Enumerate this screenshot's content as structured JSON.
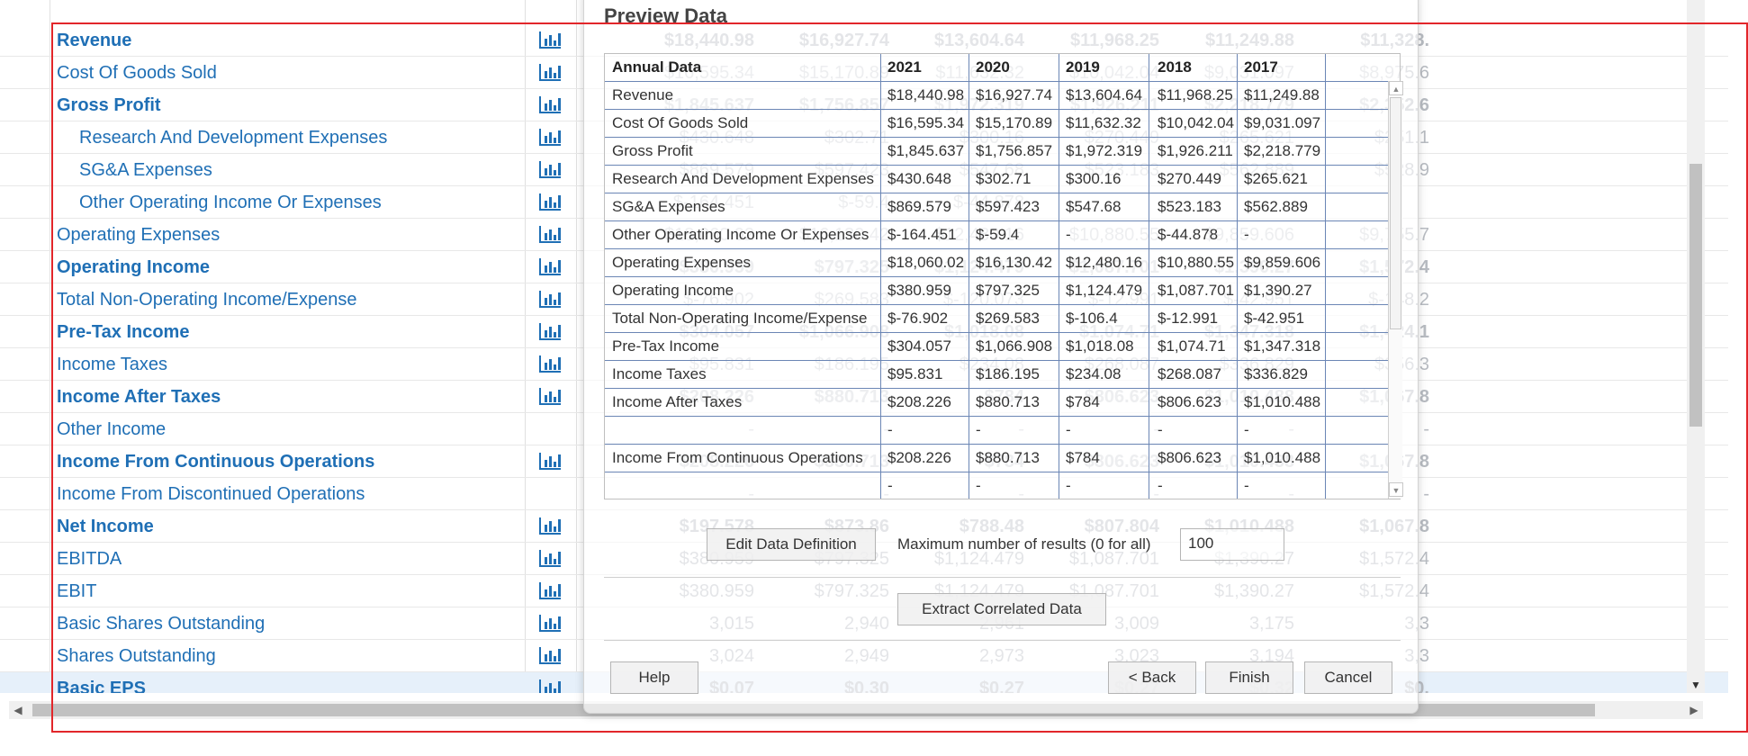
{
  "sheet": {
    "rows": [
      {
        "label": "Revenue",
        "bold": true,
        "indent": false,
        "icon": true,
        "values": [
          "$18,440.98",
          "$16,927.74",
          "$13,604.64",
          "$11,968.25",
          "$11,249.88",
          "$11,328."
        ]
      },
      {
        "label": "Cost Of Goods Sold",
        "bold": false,
        "indent": false,
        "icon": true,
        "values": [
          "$16,595.34",
          "$15,170.89",
          "$11,632.32",
          "$10,042.04",
          "$9,031.097",
          "$8,975.6"
        ]
      },
      {
        "label": "Gross Profit",
        "bold": true,
        "indent": false,
        "icon": true,
        "values": [
          "$1,845.637",
          "$1,756.857",
          "$1,972.319",
          "$1,926.211",
          "$2,218.779",
          "$2,352.6"
        ]
      },
      {
        "label": "Research And Development Expenses",
        "bold": false,
        "indent": true,
        "icon": true,
        "values": [
          "$430.648",
          "$302.71",
          "$300.16",
          "$270.449",
          "$265.621",
          "$251.1"
        ]
      },
      {
        "label": "SG&A Expenses",
        "bold": false,
        "indent": true,
        "icon": true,
        "values": [
          "$869.579",
          "$597.423",
          "$547.68",
          "$523.183",
          "$562.889",
          "$528.9"
        ]
      },
      {
        "label": "Other Operating Income Or Expenses",
        "bold": false,
        "indent": true,
        "icon": true,
        "values": [
          "$-164.451",
          "$-59.4",
          "$-44.878",
          "",
          "",
          ""
        ]
      },
      {
        "label": "Operating Expenses",
        "bold": false,
        "indent": false,
        "icon": true,
        "values": [
          "$18,060.02",
          "$16,130.42",
          "$12,480.16",
          "$10,880.55",
          "$9,859.606",
          "$9,755.7"
        ]
      },
      {
        "label": "Operating Income",
        "bold": true,
        "indent": false,
        "icon": true,
        "values": [
          "$380.959",
          "$797.325",
          "$1,124.479",
          "$1,087.701",
          "$1,390.27",
          "$1,572.4"
        ]
      },
      {
        "label": "Total Non-Operating Income/Expense",
        "bold": false,
        "indent": false,
        "icon": true,
        "values": [
          "$-76.902",
          "$269.583",
          "$-120.073",
          "$-12.991",
          "$-42.951",
          "$-148.2"
        ]
      },
      {
        "label": "Pre-Tax Income",
        "bold": true,
        "indent": false,
        "icon": true,
        "values": [
          "$304.057",
          "$1,066.908",
          "$1,018.08",
          "$1,074.71",
          "$1,347.318",
          "$1,424.1"
        ]
      },
      {
        "label": "Income Taxes",
        "bold": false,
        "indent": false,
        "icon": true,
        "values": [
          "$95.831",
          "$186.195",
          "$234.08",
          "$268.087",
          "$336.829",
          "$356.3"
        ]
      },
      {
        "label": "Income After Taxes",
        "bold": true,
        "indent": false,
        "icon": true,
        "values": [
          "$208.226",
          "$880.713",
          "$784",
          "$806.623",
          "$1,010.488",
          "$1,067.8"
        ]
      },
      {
        "label": "Other Income",
        "bold": false,
        "indent": false,
        "icon": false,
        "values": [
          "-",
          "-",
          "-",
          "-",
          "-",
          "-"
        ]
      },
      {
        "label": "Income From Continuous Operations",
        "bold": true,
        "indent": false,
        "icon": true,
        "values": [
          "$208.226",
          "$880.713",
          "$784",
          "$806.623",
          "$1,010.488",
          "$1,067.8"
        ]
      },
      {
        "label": "Income From Discontinued Operations",
        "bold": false,
        "indent": false,
        "icon": false,
        "values": [
          "-",
          "-",
          "-",
          "-",
          "-",
          "-"
        ]
      },
      {
        "label": "Net Income",
        "bold": true,
        "indent": false,
        "icon": true,
        "values": [
          "$197.578",
          "$873.86",
          "$788.48",
          "$807.804",
          "$1,010.488",
          "$1,067.8"
        ]
      },
      {
        "label": "EBITDA",
        "bold": false,
        "indent": false,
        "icon": true,
        "values": [
          "$380.959",
          "$797.325",
          "$1,124.479",
          "$1,087.701",
          "$1,390.27",
          "$1,572.4"
        ]
      },
      {
        "label": "EBIT",
        "bold": false,
        "indent": false,
        "icon": true,
        "values": [
          "$380.959",
          "$797.325",
          "$1,124.479",
          "$1,087.701",
          "$1,390.27",
          "$1,572.4"
        ]
      },
      {
        "label": "Basic Shares Outstanding",
        "bold": false,
        "indent": false,
        "icon": true,
        "values": [
          "3,015",
          "2,940",
          "2,961",
          "3,009",
          "3,175",
          "3,3"
        ]
      },
      {
        "label": "Shares Outstanding",
        "bold": false,
        "indent": false,
        "icon": true,
        "values": [
          "3,024",
          "2,949",
          "2,973",
          "3,023",
          "3,194",
          "3,3"
        ]
      },
      {
        "label": "Basic EPS",
        "bold": true,
        "indent": false,
        "icon": true,
        "selected": true,
        "values": [
          "$0.07",
          "$0.30",
          "$0.27",
          "$0.27",
          "$0.32",
          "$0."
        ]
      }
    ]
  },
  "dialog": {
    "title": "Preview Data",
    "grid": {
      "headers": [
        "Annual Data",
        "2021",
        "2020",
        "2019",
        "2018",
        "2017"
      ],
      "rows": [
        [
          "Revenue",
          "$18,440.98",
          "$16,927.74",
          "$13,604.64",
          "$11,968.25",
          "$11,249.88"
        ],
        [
          "Cost Of Goods Sold",
          "$16,595.34",
          "$15,170.89",
          "$11,632.32",
          "$10,042.04",
          "$9,031.097"
        ],
        [
          "Gross Profit",
          "$1,845.637",
          "$1,756.857",
          "$1,972.319",
          "$1,926.211",
          "$2,218.779"
        ],
        [
          "Research And Development Expenses",
          "$430.648",
          "$302.71",
          "$300.16",
          "$270.449",
          "$265.621"
        ],
        [
          "SG&A Expenses",
          "$869.579",
          "$597.423",
          "$547.68",
          "$523.183",
          "$562.889"
        ],
        [
          "Other Operating Income Or Expenses",
          "$-164.451",
          "$-59.4",
          "-",
          "$-44.878",
          "-"
        ],
        [
          "Operating Expenses",
          "$18,060.02",
          "$16,130.42",
          "$12,480.16",
          "$10,880.55",
          "$9,859.606"
        ],
        [
          "Operating Income",
          "$380.959",
          "$797.325",
          "$1,124.479",
          "$1,087.701",
          "$1,390.27"
        ],
        [
          "Total Non-Operating Income/Expense",
          "$-76.902",
          "$269.583",
          "$-106.4",
          "$-12.991",
          "$-42.951"
        ],
        [
          "Pre-Tax Income",
          "$304.057",
          "$1,066.908",
          "$1,018.08",
          "$1,074.71",
          "$1,347.318"
        ],
        [
          "Income Taxes",
          "$95.831",
          "$186.195",
          "$234.08",
          "$268.087",
          "$336.829"
        ],
        [
          "Income After Taxes",
          "$208.226",
          "$880.713",
          "$784",
          "$806.623",
          "$1,010.488"
        ],
        [
          "",
          "-",
          "-",
          "-",
          "-",
          "-"
        ],
        [
          "Income From Continuous Operations",
          "$208.226",
          "$880.713",
          "$784",
          "$806.623",
          "$1,010.488"
        ],
        [
          "",
          "-",
          "-",
          "-",
          "-",
          "-"
        ]
      ]
    },
    "edit_button": "Edit Data Definition",
    "max_results_label": "Maximum number of results (0 for all)",
    "max_results_value": "100",
    "extract_button": "Extract Correlated Data",
    "help_button": "Help",
    "back_button": "< Back",
    "finish_button": "Finish",
    "cancel_button": "Cancel"
  },
  "colors": {
    "link": "#1f6fb5",
    "frame": "#e2262a",
    "grid_line": "#6b86b5"
  }
}
